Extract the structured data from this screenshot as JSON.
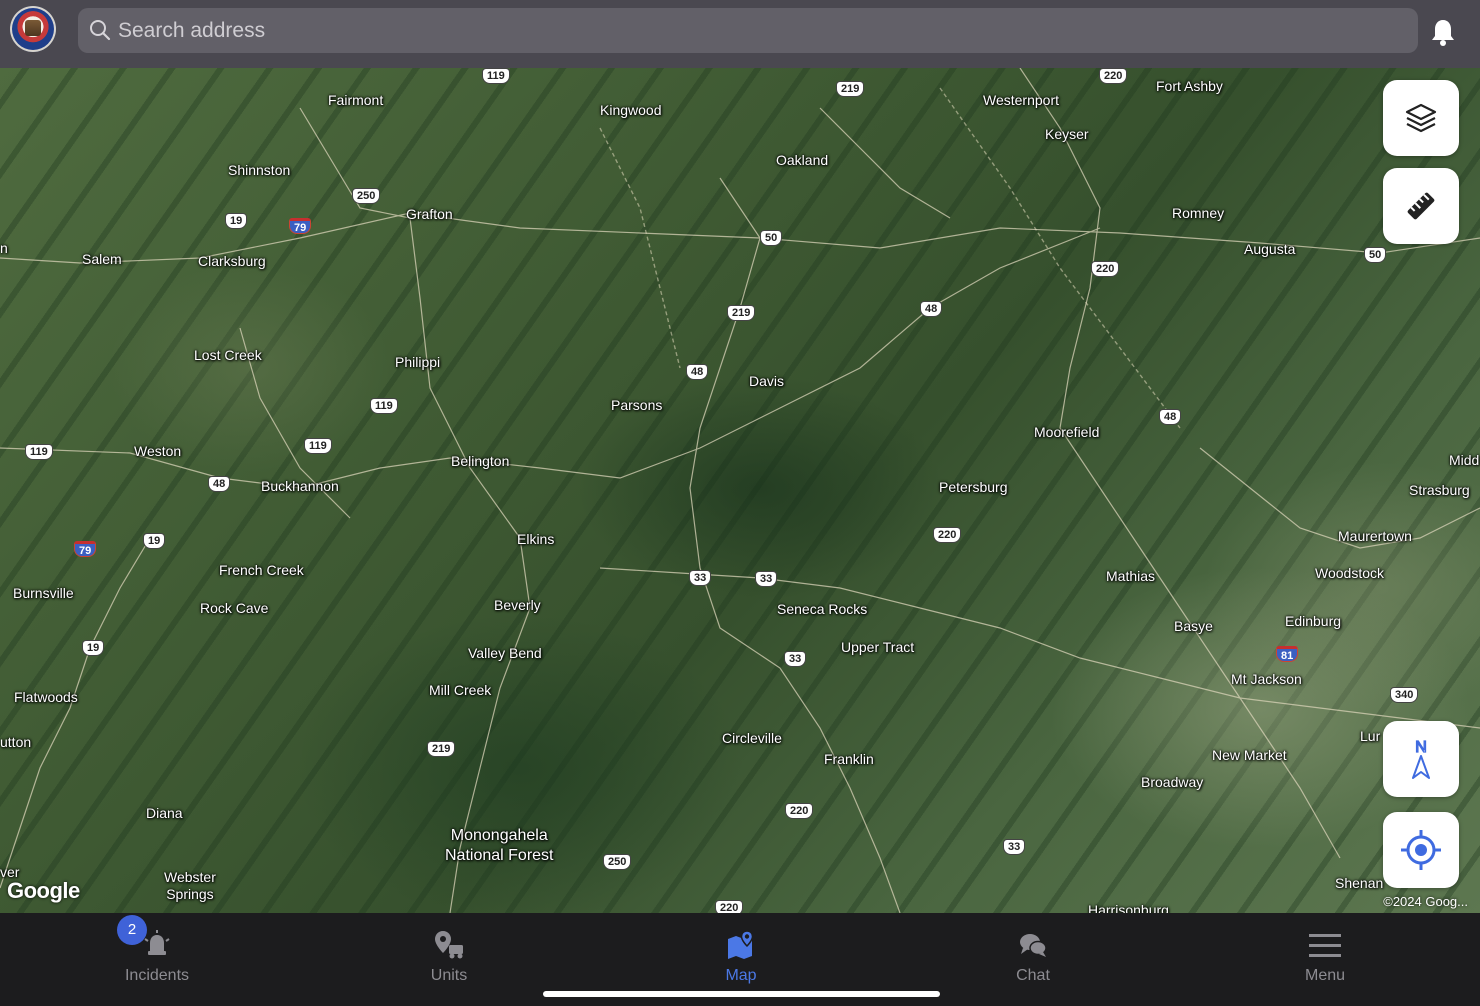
{
  "search": {
    "placeholder": "Search address"
  },
  "map": {
    "attribution": "Google",
    "copyright": "©2024 Goog...",
    "places": [
      {
        "name": "Fairmont",
        "l": 328,
        "t": 24
      },
      {
        "name": "Kingwood",
        "l": 600,
        "t": 34
      },
      {
        "name": "Westernport",
        "l": 983,
        "t": 24
      },
      {
        "name": "Fort Ashby",
        "l": 1156,
        "t": 10
      },
      {
        "name": "Keyser",
        "l": 1045,
        "t": 58
      },
      {
        "name": "Oakland",
        "l": 776,
        "t": 84
      },
      {
        "name": "Shinnston",
        "l": 228,
        "t": 94
      },
      {
        "name": "Grafton",
        "l": 406,
        "t": 138
      },
      {
        "name": "Romney",
        "l": 1172,
        "t": 137
      },
      {
        "name": "Augusta",
        "l": 1244,
        "t": 173
      },
      {
        "name": "Salem",
        "l": 82,
        "t": 183
      },
      {
        "name": "Clarksburg",
        "l": 198,
        "t": 185
      },
      {
        "name": "Lost Creek",
        "l": 194,
        "t": 279
      },
      {
        "name": "Philippi",
        "l": 395,
        "t": 286
      },
      {
        "name": "Davis",
        "l": 749,
        "t": 305
      },
      {
        "name": "Parsons",
        "l": 611,
        "t": 329
      },
      {
        "name": "Moorefield",
        "l": 1034,
        "t": 356
      },
      {
        "name": "Weston",
        "l": 134,
        "t": 375
      },
      {
        "name": "Belington",
        "l": 451,
        "t": 385
      },
      {
        "name": "Buckhannon",
        "l": 261,
        "t": 410
      },
      {
        "name": "Petersburg",
        "l": 939,
        "t": 411
      },
      {
        "name": "Strasburg",
        "l": 1409,
        "t": 414
      },
      {
        "name": "Midd",
        "l": 1449,
        "t": 384
      },
      {
        "name": "Elkins",
        "l": 517,
        "t": 463
      },
      {
        "name": "Maurertown",
        "l": 1338,
        "t": 460
      },
      {
        "name": "French Creek",
        "l": 219,
        "t": 494
      },
      {
        "name": "Woodstock",
        "l": 1315,
        "t": 497
      },
      {
        "name": "Mathias",
        "l": 1106,
        "t": 500
      },
      {
        "name": "Burnsville",
        "l": 13,
        "t": 517
      },
      {
        "name": "Beverly",
        "l": 494,
        "t": 529
      },
      {
        "name": "Rock Cave",
        "l": 200,
        "t": 532
      },
      {
        "name": "Seneca Rocks",
        "l": 777,
        "t": 533
      },
      {
        "name": "Edinburg",
        "l": 1285,
        "t": 545
      },
      {
        "name": "Basye",
        "l": 1174,
        "t": 550
      },
      {
        "name": "Upper Tract",
        "l": 841,
        "t": 571
      },
      {
        "name": "Valley Bend",
        "l": 468,
        "t": 577
      },
      {
        "name": "Mt Jackson",
        "l": 1231,
        "t": 603
      },
      {
        "name": "Mill Creek",
        "l": 429,
        "t": 614
      },
      {
        "name": "Flatwoods",
        "l": 14,
        "t": 621
      },
      {
        "name": "utton",
        "l": 0,
        "t": 666
      },
      {
        "name": "Circleville",
        "l": 722,
        "t": 662
      },
      {
        "name": "Lur",
        "l": 1360,
        "t": 660
      },
      {
        "name": "Franklin",
        "l": 824,
        "t": 683
      },
      {
        "name": "New Market",
        "l": 1212,
        "t": 679
      },
      {
        "name": "Broadway",
        "l": 1141,
        "t": 706
      },
      {
        "name": "Diana",
        "l": 146,
        "t": 737
      },
      {
        "name": "Webster\nSprings",
        "l": 164,
        "t": 801
      },
      {
        "name": "Shenan",
        "l": 1335,
        "t": 807
      },
      {
        "name": "Harrisonburg",
        "l": 1088,
        "t": 834
      },
      {
        "name": "ver",
        "l": 0,
        "t": 796
      },
      {
        "name": "n",
        "l": 0,
        "t": 172
      }
    ],
    "forest_label": "Monongahela\nNational Forest",
    "shields": [
      {
        "n": "219",
        "l": 836,
        "t": 13,
        "iw": false
      },
      {
        "n": "250",
        "l": 352,
        "t": 120,
        "iw": false
      },
      {
        "n": "19",
        "l": 225,
        "t": 145,
        "iw": false
      },
      {
        "n": "79",
        "l": 289,
        "t": 150,
        "iw": true
      },
      {
        "n": "50",
        "l": 760,
        "t": 162,
        "iw": false
      },
      {
        "n": "220",
        "l": 1091,
        "t": 193,
        "iw": false
      },
      {
        "n": "50",
        "l": 1364,
        "t": 179,
        "iw": false
      },
      {
        "n": "219",
        "l": 727,
        "t": 237,
        "iw": false
      },
      {
        "n": "48",
        "l": 920,
        "t": 233,
        "iw": false
      },
      {
        "n": "48",
        "l": 686,
        "t": 296,
        "iw": false
      },
      {
        "n": "119",
        "l": 370,
        "t": 330,
        "iw": false
      },
      {
        "n": "48",
        "l": 1159,
        "t": 341,
        "iw": false
      },
      {
        "n": "119",
        "l": 304,
        "t": 370,
        "iw": false
      },
      {
        "n": "119",
        "l": 25,
        "t": 376,
        "iw": false
      },
      {
        "n": "48",
        "l": 208,
        "t": 408,
        "iw": false
      },
      {
        "n": "220",
        "l": 933,
        "t": 459,
        "iw": false
      },
      {
        "n": "19",
        "l": 143,
        "t": 465,
        "iw": false
      },
      {
        "n": "79",
        "l": 74,
        "t": 473,
        "iw": true
      },
      {
        "n": "33",
        "l": 689,
        "t": 502,
        "iw": false
      },
      {
        "n": "33",
        "l": 755,
        "t": 503,
        "iw": false
      },
      {
        "n": "81",
        "l": 1276,
        "t": 578,
        "iw": true
      },
      {
        "n": "19",
        "l": 82,
        "t": 572,
        "iw": false
      },
      {
        "n": "33",
        "l": 784,
        "t": 583,
        "iw": false
      },
      {
        "n": "340",
        "l": 1390,
        "t": 619,
        "iw": false
      },
      {
        "n": "219",
        "l": 427,
        "t": 673,
        "iw": false
      },
      {
        "n": "220",
        "l": 785,
        "t": 735,
        "iw": false
      },
      {
        "n": "33",
        "l": 1003,
        "t": 771,
        "iw": false
      },
      {
        "n": "250",
        "l": 603,
        "t": 786,
        "iw": false
      },
      {
        "n": "220",
        "l": 715,
        "t": 832,
        "iw": false
      },
      {
        "n": "220",
        "l": 1099,
        "t": 0,
        "iw": false
      },
      {
        "n": "119",
        "l": 482,
        "t": 0,
        "iw": false
      }
    ],
    "compass_letter": "N"
  },
  "nav": {
    "items": [
      {
        "label": "Incidents",
        "badge": "2"
      },
      {
        "label": "Units"
      },
      {
        "label": "Map"
      },
      {
        "label": "Chat"
      },
      {
        "label": "Menu"
      }
    ]
  },
  "colors": {
    "accent": "#4b78e6",
    "badge": "#3f62d8",
    "inactive": "#8d8c92",
    "topbar": "#4a4850"
  }
}
